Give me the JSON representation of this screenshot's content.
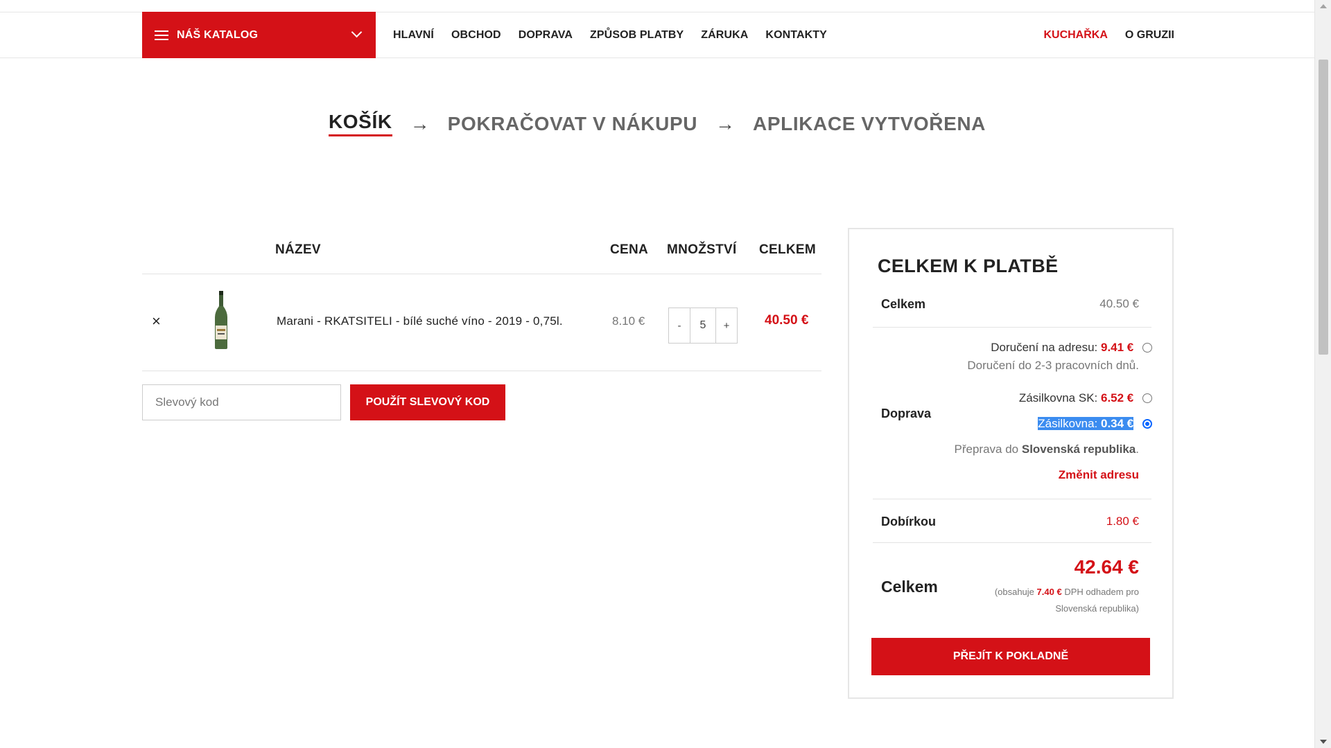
{
  "header": {
    "catalog_label": "NÁŠ KATALOG",
    "menu": [
      "HLAVNÍ",
      "OBCHOD",
      "DOPRAVA",
      "ZPŮSOB PLATBY",
      "ZÁRUKA",
      "KONTAKTY"
    ],
    "menu_right": [
      "KUCHAŘKA",
      "O GRUZII"
    ],
    "accent_color": "#d41117"
  },
  "steps": {
    "cart": "KOŠÍK",
    "continue": "POKRAČOVAT V NÁKUPU",
    "created": "APLIKACE VYTVOŘENA",
    "arrow": "→"
  },
  "cart": {
    "columns": {
      "name": "NÁZEV",
      "price": "CENA",
      "qty": "MNOŽSTVÍ",
      "total": "CELKEM"
    },
    "items": [
      {
        "remove": "×",
        "name": "Marani - RKATSITELI - bílé suché víno - 2019 - 0,75l.",
        "price": "8.10 €",
        "qty": "5",
        "total": "40.50 €"
      }
    ],
    "qty_minus": "-",
    "qty_plus": "+",
    "coupon_placeholder": "Slevový kod",
    "coupon_button": "POUŽÍT SLEVOVÝ KOD"
  },
  "totals": {
    "title": "CELKEM K PLATBĚ",
    "subtotal_label": "Celkem",
    "subtotal_value": "40.50 €",
    "shipping_label": "Doprava",
    "ship_options": [
      {
        "label": "Doručení na adresu:",
        "price": "9.41 €",
        "selected": false
      },
      {
        "label": "Zásilkovna SK:",
        "price": "6.52 €",
        "selected": false
      },
      {
        "label": "Zásilkovna:",
        "price": "0.34 €",
        "selected": true
      }
    ],
    "ship_address_note": "Doručení do 2-3 pracovních dnů.",
    "ship_dest_prefix": "Přeprava do",
    "ship_dest_country": "Slovenská republika",
    "ship_dest_suffix": ".",
    "change_address": "Změnit adresu",
    "cod_label": "Dobírkou",
    "cod_value": "1.80 €",
    "grand_label": "Celkem",
    "grand_value": "42.64 €",
    "vat_prefix": "(obsahuje",
    "vat_value": "7.40 €",
    "vat_suffix": "DPH odhadem pro Slovenská republika)",
    "checkout_button": "PŘEJÍT K POKLADNĚ"
  }
}
